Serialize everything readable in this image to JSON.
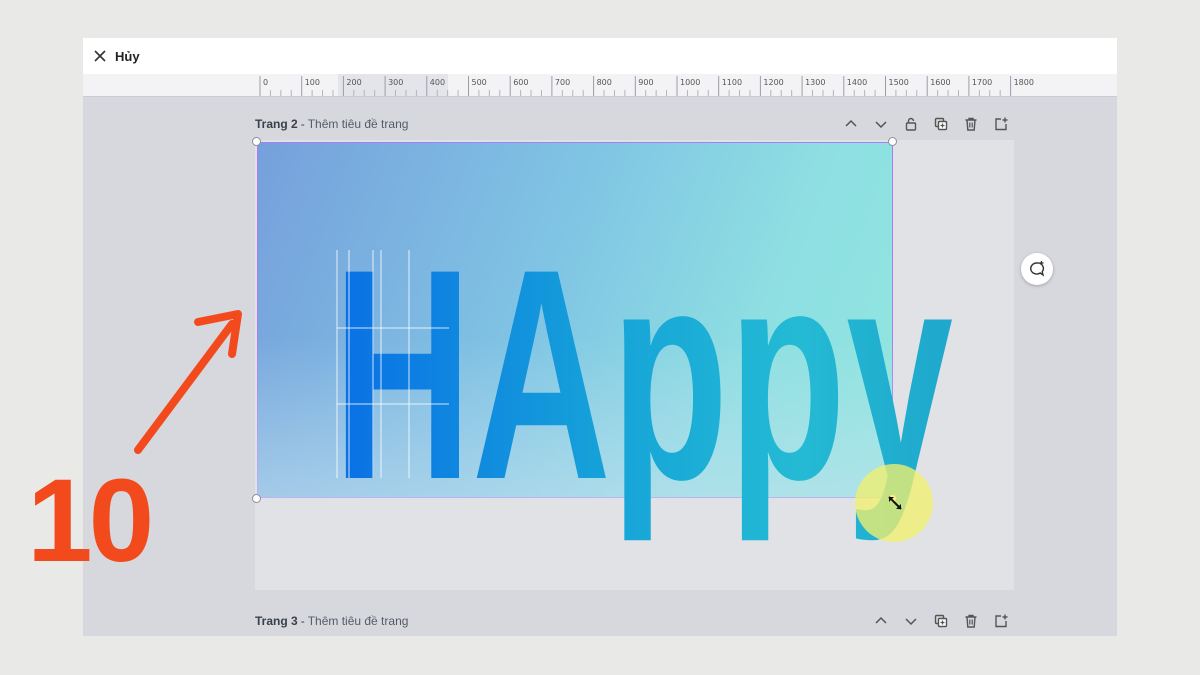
{
  "toolbar": {
    "cancel_label": "Hủy",
    "cancel_icon": "close-icon"
  },
  "ruler": {
    "labels": [
      "0",
      "100",
      "200",
      "300",
      "400",
      "500",
      "600",
      "700",
      "800",
      "900",
      "1000",
      "1100",
      "1200",
      "1300",
      "1400",
      "1500",
      "1600",
      "1700",
      "1800"
    ]
  },
  "pages": [
    {
      "number": "Trang 2",
      "title_placeholder": "Thêm tiêu đề trang"
    },
    {
      "number": "Trang 3",
      "title_placeholder": "Thêm tiêu đề trang"
    }
  ],
  "page_tools": [
    "chevron-up-icon",
    "chevron-down-icon",
    "lock-icon",
    "duplicate-icon",
    "trash-icon",
    "add-page-icon"
  ],
  "canvas": {
    "text": "HAppy",
    "gradient_colors": [
      "#76a0dc",
      "#90e6df"
    ],
    "text_colors": [
      "#0a6fe6",
      "#22b6d6"
    ]
  },
  "overlay": {
    "step_number": "10",
    "accent_color": "#f24a1c"
  }
}
